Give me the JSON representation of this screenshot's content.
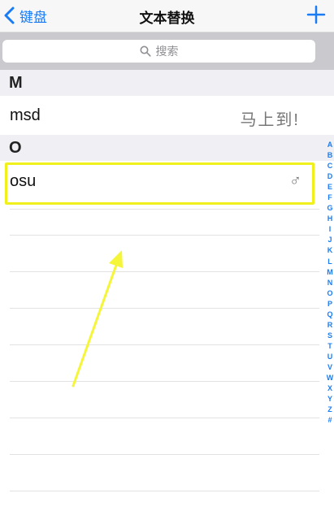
{
  "nav": {
    "back_label": "键盘",
    "title": "文本替换"
  },
  "search": {
    "placeholder": "搜索"
  },
  "sections": [
    {
      "header": "M",
      "rows": [
        {
          "phrase": "msd",
          "shortcut": "马上到!"
        }
      ]
    },
    {
      "header": "O",
      "rows": [
        {
          "phrase": "osu",
          "shortcut": "♂"
        }
      ]
    }
  ],
  "index_letters": [
    "A",
    "B",
    "C",
    "D",
    "E",
    "F",
    "G",
    "H",
    "I",
    "J",
    "K",
    "L",
    "M",
    "N",
    "O",
    "P",
    "Q",
    "R",
    "S",
    "T",
    "U",
    "V",
    "W",
    "X",
    "Y",
    "Z",
    "#"
  ],
  "colors": {
    "accent": "#1a7cf5",
    "highlight": "#f0f01c",
    "arrow": "#f5f53a"
  }
}
